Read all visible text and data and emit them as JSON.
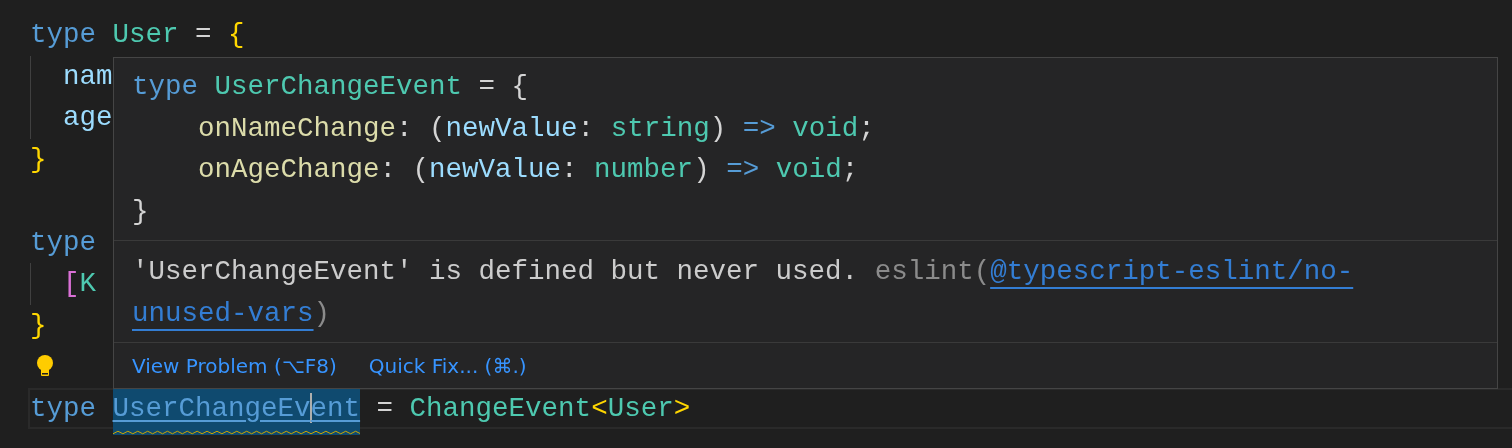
{
  "editor": {
    "lines": [
      {
        "indented": false,
        "tokens": [
          {
            "text": "type",
            "kind": "keyword"
          },
          {
            "kind": "space"
          },
          {
            "text": "User",
            "kind": "type"
          },
          {
            "kind": "space"
          },
          {
            "text": "=",
            "kind": "punct"
          },
          {
            "kind": "space"
          },
          {
            "text": "{",
            "kind": "brace"
          }
        ]
      },
      {
        "indented": true,
        "tokens": [
          {
            "text": "nam",
            "kind": "prop"
          }
        ]
      },
      {
        "indented": true,
        "tokens": [
          {
            "text": "age",
            "kind": "prop"
          }
        ]
      },
      {
        "indented": false,
        "tokens": [
          {
            "text": "}",
            "kind": "brace"
          }
        ]
      },
      {
        "indented": false
      },
      {
        "indented": false,
        "tokens": [
          {
            "text": "type",
            "kind": "keyword"
          }
        ]
      },
      {
        "indented": true,
        "tokens": [
          {
            "text": "[",
            "kind": "pink"
          },
          {
            "text": "K",
            "kind": "type"
          }
        ]
      },
      {
        "indented": false,
        "tokens": [
          {
            "text": "}",
            "kind": "brace"
          }
        ]
      },
      {
        "indented": false,
        "lightbulb": true
      },
      {
        "indented": false,
        "current": true,
        "tokens": [
          {
            "text": "type",
            "kind": "keyword"
          },
          {
            "kind": "space"
          },
          {
            "kind": "link",
            "before_cursor": "UserChangeEv",
            "after_cursor": "ent"
          },
          {
            "kind": "space"
          },
          {
            "text": "=",
            "kind": "punct"
          },
          {
            "kind": "space"
          },
          {
            "text": "ChangeEvent",
            "kind": "type"
          },
          {
            "text": "<",
            "kind": "brace"
          },
          {
            "text": "User",
            "kind": "type"
          },
          {
            "text": ">",
            "kind": "brace"
          }
        ]
      }
    ]
  },
  "hover": {
    "code": [
      {
        "indented": false,
        "tokens": [
          {
            "text": "type",
            "kind": "keyword"
          },
          {
            "kind": "space"
          },
          {
            "text": "UserChangeEvent",
            "kind": "type"
          },
          {
            "kind": "space"
          },
          {
            "text": "=",
            "kind": "punct"
          },
          {
            "kind": "space"
          },
          {
            "text": "{",
            "kind": "punct"
          }
        ]
      },
      {
        "indented": true,
        "tokens": [
          {
            "text": "onNameChange",
            "kind": "func"
          },
          {
            "text": ":",
            "kind": "punct"
          },
          {
            "kind": "space"
          },
          {
            "text": "(",
            "kind": "punct"
          },
          {
            "text": "newValue",
            "kind": "prop"
          },
          {
            "text": ":",
            "kind": "punct"
          },
          {
            "kind": "space"
          },
          {
            "text": "string",
            "kind": "type"
          },
          {
            "text": ")",
            "kind": "punct"
          },
          {
            "kind": "space"
          },
          {
            "text": "=>",
            "kind": "keyword"
          },
          {
            "kind": "space"
          },
          {
            "text": "void",
            "kind": "type"
          },
          {
            "text": ";",
            "kind": "punct"
          }
        ]
      },
      {
        "indented": true,
        "tokens": [
          {
            "text": "onAgeChange",
            "kind": "func"
          },
          {
            "text": ":",
            "kind": "punct"
          },
          {
            "kind": "space"
          },
          {
            "text": "(",
            "kind": "punct"
          },
          {
            "text": "newValue",
            "kind": "prop"
          },
          {
            "text": ":",
            "kind": "punct"
          },
          {
            "kind": "space"
          },
          {
            "text": "number",
            "kind": "type"
          },
          {
            "text": ")",
            "kind": "punct"
          },
          {
            "kind": "space"
          },
          {
            "text": "=>",
            "kind": "keyword"
          },
          {
            "kind": "space"
          },
          {
            "text": "void",
            "kind": "type"
          },
          {
            "text": ";",
            "kind": "punct"
          }
        ]
      },
      {
        "indented": false,
        "tokens": [
          {
            "text": "}",
            "kind": "punct"
          }
        ]
      }
    ],
    "message": {
      "text": "'UserChangeEvent' is defined but never used.",
      "source": "eslint(",
      "link_lines": [
        "@typescript-eslint/no-",
        "unused-vars"
      ],
      "close": ")"
    },
    "actions": [
      "View Problem (⌥F8)",
      "Quick Fix... (⌘.)"
    ]
  }
}
